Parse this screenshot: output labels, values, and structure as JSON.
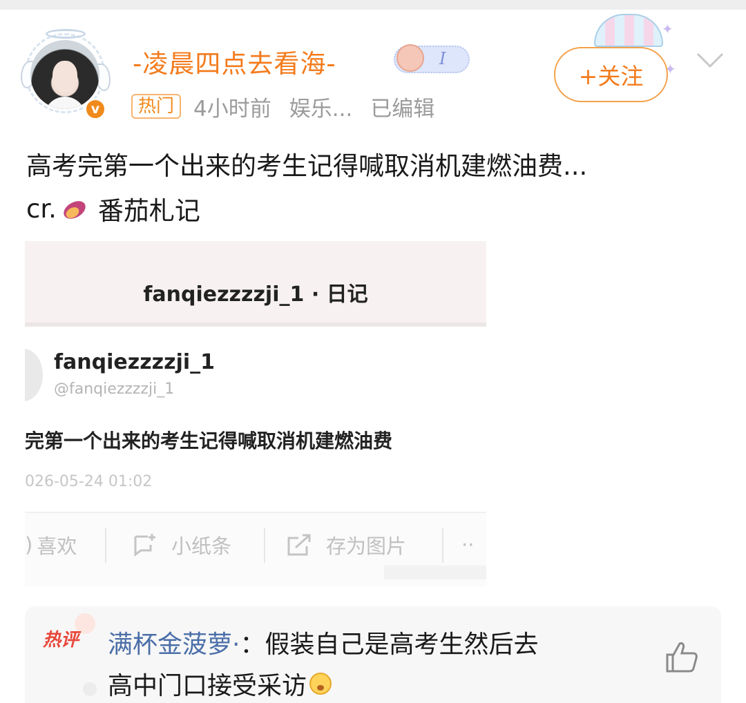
{
  "post": {
    "username": "-凌晨四点去看海-",
    "meta": {
      "tag": "热门",
      "time": "4小时前",
      "category": "娱乐...",
      "edited": "已编辑"
    },
    "follow_label": "+关注",
    "text_line1": "高考完第一个出来的考生记得喊取消机建燃油费...",
    "credit_prefix": "cr.",
    "credit_name": "番茄札记"
  },
  "embedded": {
    "header_title": "fanqiezzzzji_1 · 日记",
    "author_name": "fanqiezzzzji_1",
    "author_handle": "@fanqiezzzzji_1",
    "body_text": "完第一个出来的考生记得喊取消机建燃油费",
    "date": "026-05-24 01:02",
    "actions": {
      "like": "喜欢",
      "note": "小纸条",
      "save": "存为图片",
      "more": "··"
    }
  },
  "hot_comment": {
    "label": "热评",
    "user": "满杯金菠萝·",
    "text_line1": "假装自己是高考生然后去",
    "text_line2": "高中门口接受采访"
  },
  "colors": {
    "accent": "#f37b1d",
    "hot": "#e8473a",
    "link_user": "#4a6ea8",
    "meta": "#9b9b9b"
  },
  "icons": [
    "verified-badge-icon",
    "chevron-down-icon",
    "sweet-potato-emoji",
    "thumbs-up-icon",
    "crying-face-emoji"
  ]
}
